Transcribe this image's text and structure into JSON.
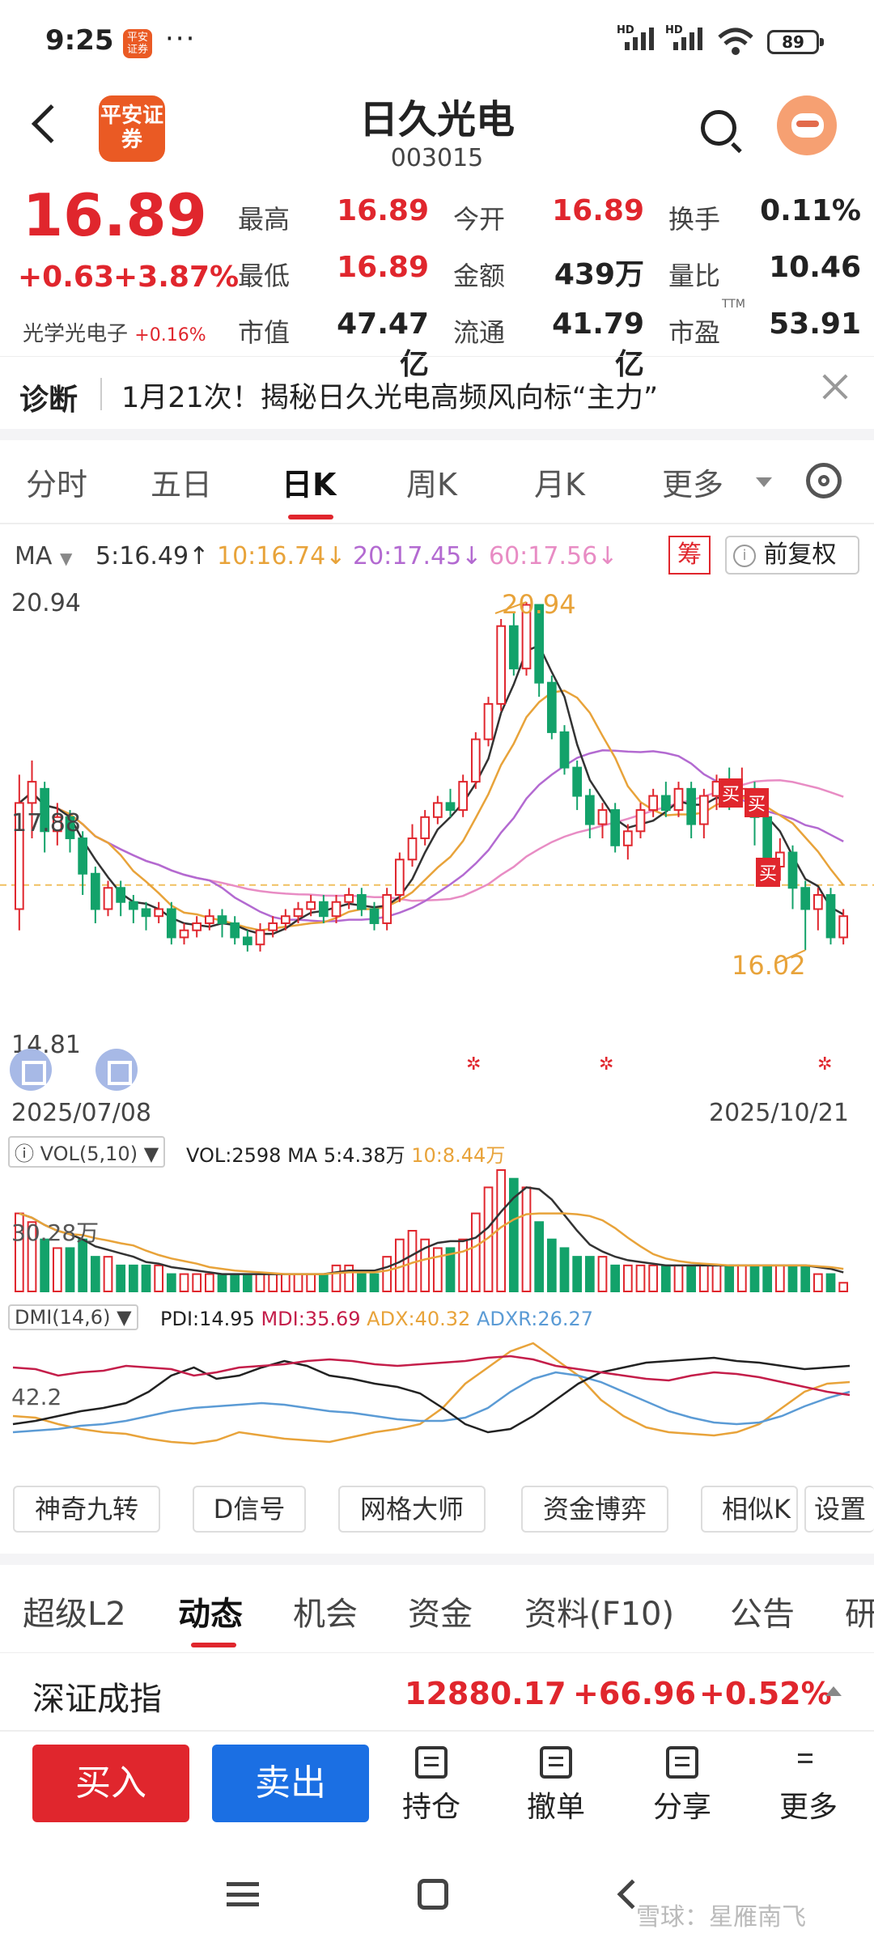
{
  "status_bar": {
    "time": "9:25",
    "app_icon_text": "平安证券",
    "more": "···",
    "hd1": "HD",
    "hd2": "HD",
    "battery": "89"
  },
  "header": {
    "logo_text": "平安证券",
    "title": "日久光电",
    "code": "003015"
  },
  "quote": {
    "price": "16.89",
    "change": "+0.63",
    "change_pct": "+3.87%",
    "sector_name": "光学光电子",
    "sector_pct": "+0.16%",
    "rows": [
      [
        {
          "label": "最高",
          "value": "16.89",
          "color": "red"
        },
        {
          "label": "今开",
          "value": "16.89",
          "color": "red"
        },
        {
          "label": "换手",
          "value": "0.11%",
          "color": "dark"
        }
      ],
      [
        {
          "label": "最低",
          "value": "16.89",
          "color": "red"
        },
        {
          "label": "金额",
          "value": "439万",
          "color": "dark"
        },
        {
          "label": "量比",
          "value": "10.46",
          "color": "dark"
        }
      ],
      [
        {
          "label": "市值",
          "value": "47.47亿",
          "color": "dark"
        },
        {
          "label": "流通",
          "value": "41.79亿",
          "color": "dark"
        },
        {
          "label": "市盈",
          "value": "53.91",
          "color": "dark"
        }
      ]
    ],
    "ttm": "TTM"
  },
  "diagnosis": {
    "label": "诊断",
    "text": "1月21次！揭秘日久光电高频风向标“主力”"
  },
  "period_tabs": [
    "分时",
    "五日",
    "日K",
    "周K",
    "月K",
    "更多"
  ],
  "active_period": "日K",
  "ma_legend": {
    "name": "MA",
    "ma5": "5:16.49↑",
    "ma10": "10:16.74↓",
    "ma20": "20:17.45↓",
    "ma60": "60:17.56↓",
    "chip": "筹",
    "adjust": "前复权",
    "adjust_icon": "i"
  },
  "colors": {
    "ma5": "#333333",
    "ma10": "#e8a33a",
    "ma20": "#b36ad1",
    "ma60": "#e88cc4",
    "up": "#e0262d",
    "down": "#13a26a",
    "dmi_pdi": "#222222",
    "dmi_mdi": "#c41e4a",
    "dmi_adx": "#e8a33a",
    "dmi_adxr": "#5b9bd5"
  },
  "chart": {
    "y_high": "20.94",
    "y_mid": "17.88",
    "y_low": "14.81",
    "hi_mark": "20.94",
    "lo_mark": "16.02",
    "date_start": "2025/07/08",
    "date_end": "2025/10/21",
    "buy_tag": "买"
  },
  "vol_legend": {
    "name": "VOL(5,10)",
    "vol": "VOL:2598",
    "ma5": "MA 5:4.38万",
    "ma10": "10:8.44万",
    "axis": "30.28万"
  },
  "dmi_legend": {
    "name": "DMI(14,6)",
    "pdi": "PDI:14.95",
    "mdi": "MDI:35.69",
    "adx": "ADX:40.32",
    "adxr": "ADXR:26.27",
    "axis": "42.2"
  },
  "tools": [
    "神奇九转",
    "D信号",
    "网格大师",
    "资金博弈",
    "相似K",
    "设置"
  ],
  "bottom_tabs": [
    "超级L2",
    "动态",
    "机会",
    "资金",
    "资料(F10)",
    "公告",
    "研"
  ],
  "active_bottom_tab": "动态",
  "index": {
    "name": "深证成指",
    "value": "12880.17",
    "change": "+66.96",
    "pct": "+0.52%"
  },
  "actions": {
    "buy": "买入",
    "sell": "卖出",
    "hold": "持仓",
    "cancel": "撤单",
    "share": "分享",
    "more": "更多"
  },
  "watermark": "雪球：星雁南飞",
  "chart_data": {
    "type": "candlestick",
    "x_range": [
      "2025/07/08",
      "2025/10/21"
    ],
    "ylim": [
      14.81,
      20.94
    ],
    "high_label": 20.94,
    "low_label": 16.02,
    "candles": [
      [
        16.6,
        18.1,
        18.5,
        16.3
      ],
      [
        18.1,
        18.4,
        18.7,
        17.6
      ],
      [
        18.3,
        17.7,
        18.4,
        17.4
      ],
      [
        17.7,
        17.9,
        18.1,
        17.5
      ],
      [
        17.9,
        17.6,
        18.0,
        17.4
      ],
      [
        17.6,
        17.1,
        17.7,
        16.8
      ],
      [
        17.1,
        16.6,
        17.2,
        16.4
      ],
      [
        16.6,
        16.9,
        17.0,
        16.5
      ],
      [
        16.9,
        16.7,
        17.0,
        16.5
      ],
      [
        16.7,
        16.6,
        16.8,
        16.4
      ],
      [
        16.6,
        16.5,
        16.7,
        16.3
      ],
      [
        16.5,
        16.6,
        16.7,
        16.4
      ],
      [
        16.6,
        16.2,
        16.7,
        16.1
      ],
      [
        16.2,
        16.3,
        16.4,
        16.1
      ],
      [
        16.3,
        16.4,
        16.5,
        16.2
      ],
      [
        16.4,
        16.5,
        16.6,
        16.3
      ],
      [
        16.5,
        16.4,
        16.6,
        16.2
      ],
      [
        16.4,
        16.2,
        16.5,
        16.1
      ],
      [
        16.2,
        16.1,
        16.3,
        16.0
      ],
      [
        16.1,
        16.3,
        16.4,
        16.0
      ],
      [
        16.3,
        16.4,
        16.5,
        16.2
      ],
      [
        16.4,
        16.5,
        16.6,
        16.3
      ],
      [
        16.5,
        16.6,
        16.7,
        16.4
      ],
      [
        16.6,
        16.7,
        16.8,
        16.5
      ],
      [
        16.7,
        16.5,
        16.8,
        16.4
      ],
      [
        16.5,
        16.7,
        16.8,
        16.4
      ],
      [
        16.7,
        16.8,
        16.9,
        16.6
      ],
      [
        16.8,
        16.6,
        16.9,
        16.5
      ],
      [
        16.6,
        16.4,
        16.7,
        16.3
      ],
      [
        16.4,
        16.8,
        16.9,
        16.3
      ],
      [
        16.8,
        17.3,
        17.4,
        16.7
      ],
      [
        17.3,
        17.6,
        17.8,
        17.2
      ],
      [
        17.6,
        17.9,
        18.0,
        17.5
      ],
      [
        17.9,
        18.1,
        18.2,
        17.8
      ],
      [
        18.1,
        18.0,
        18.3,
        17.9
      ],
      [
        18.0,
        18.4,
        18.5,
        17.9
      ],
      [
        18.4,
        19.0,
        19.1,
        18.3
      ],
      [
        19.0,
        19.5,
        19.6,
        18.9
      ],
      [
        19.5,
        20.6,
        20.7,
        19.4
      ],
      [
        20.6,
        20.0,
        20.8,
        19.9
      ],
      [
        20.0,
        20.9,
        20.94,
        19.9
      ],
      [
        20.9,
        19.8,
        20.9,
        19.6
      ],
      [
        19.8,
        19.1,
        19.9,
        19.0
      ],
      [
        19.1,
        18.6,
        19.2,
        18.5
      ],
      [
        18.6,
        18.2,
        18.7,
        18.0
      ],
      [
        18.2,
        17.8,
        18.3,
        17.6
      ],
      [
        17.8,
        18.0,
        18.1,
        17.6
      ],
      [
        18.0,
        17.5,
        18.1,
        17.4
      ],
      [
        17.5,
        17.7,
        17.8,
        17.3
      ],
      [
        17.7,
        18.0,
        18.1,
        17.6
      ],
      [
        18.0,
        18.2,
        18.3,
        17.9
      ],
      [
        18.2,
        18.0,
        18.4,
        17.9
      ],
      [
        18.0,
        18.3,
        18.4,
        17.9
      ],
      [
        18.3,
        17.8,
        18.4,
        17.6
      ],
      [
        17.8,
        18.2,
        18.3,
        17.6
      ],
      [
        18.2,
        18.4,
        18.5,
        18.0
      ],
      [
        18.4,
        18.2,
        18.6,
        18.0
      ],
      [
        18.2,
        18.3,
        18.6,
        18.1
      ],
      [
        18.3,
        17.9,
        18.4,
        17.5
      ],
      [
        17.9,
        17.2,
        18.0,
        17.0
      ],
      [
        17.2,
        17.4,
        17.6,
        17.0
      ],
      [
        17.4,
        16.9,
        17.5,
        16.6
      ],
      [
        16.9,
        16.6,
        17.0,
        16.02
      ],
      [
        16.6,
        16.8,
        16.9,
        16.3
      ],
      [
        16.8,
        16.2,
        16.9,
        16.1
      ],
      [
        16.2,
        16.5,
        16.6,
        16.1
      ]
    ],
    "volume": [
      9,
      8,
      6,
      5,
      5,
      6,
      4,
      4,
      3,
      3,
      3,
      3,
      2,
      2,
      2,
      2,
      2,
      2,
      2,
      2,
      2,
      2,
      2,
      2,
      2,
      3,
      3,
      2,
      2,
      4,
      6,
      7,
      6,
      5,
      5,
      6,
      9,
      12,
      14,
      13,
      12,
      8,
      6,
      5,
      4,
      4,
      4,
      3,
      3,
      3,
      3,
      3,
      3,
      3,
      3,
      3,
      3,
      3,
      3,
      3,
      3,
      3,
      3,
      2,
      2,
      1
    ],
    "volume_axis": "30.28万",
    "indicators": {
      "MA5": 16.49,
      "MA10": 16.74,
      "MA20": 17.45,
      "MA60": 17.56,
      "VOL": 2598,
      "DMI_PDI": 14.95,
      "DMI_MDI": 35.69,
      "DMI_ADX": 40.32,
      "DMI_ADXR": 26.27
    }
  }
}
